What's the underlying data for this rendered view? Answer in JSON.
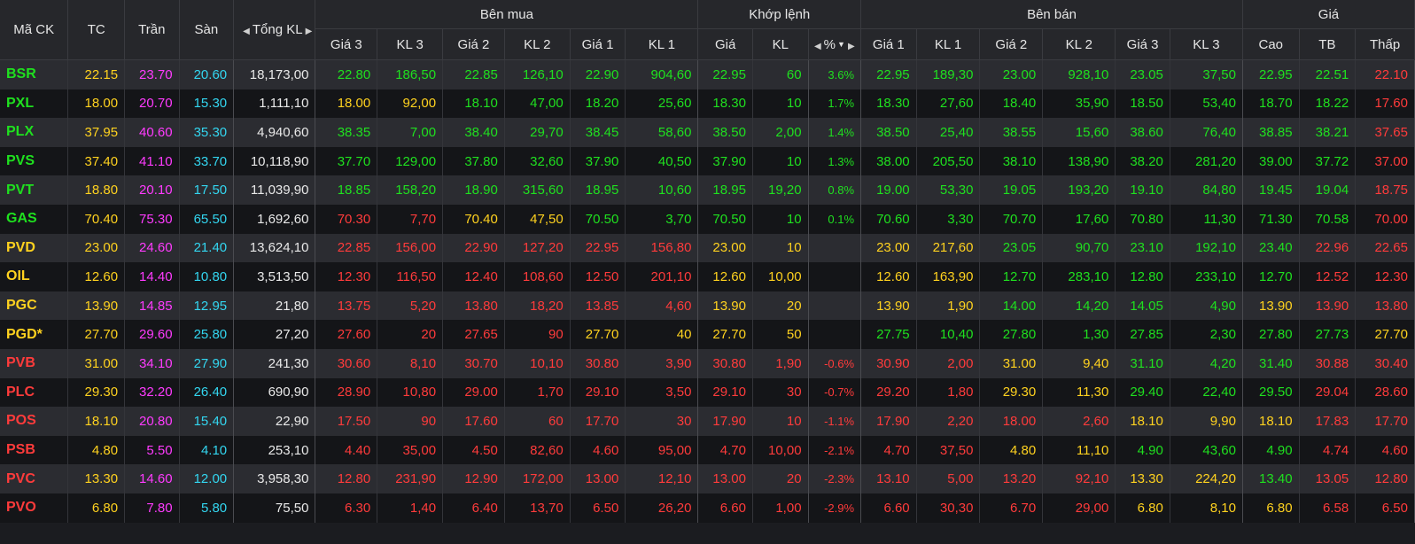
{
  "colors": {
    "green": "#1fe01f",
    "red": "#ff3b3b",
    "yellow": "#ffd21f",
    "purple": "#ff3bff",
    "cyan": "#33d6f0",
    "white": "#e9e9e9"
  },
  "header": {
    "symbol": "Mã CK",
    "ref": "TC",
    "ceil": "Trần",
    "floor": "Sàn",
    "total": "Tổng KL",
    "bid_group": "Bên mua",
    "match_group": "Khớp lệnh",
    "ask_group": "Bên bán",
    "price_group": "Giá",
    "bid_p3": "Giá 3",
    "bid_v3": "KL 3",
    "bid_p2": "Giá 2",
    "bid_v2": "KL 2",
    "bid_p1": "Giá 1",
    "bid_v1": "KL 1",
    "match_p": "Giá",
    "match_v": "KL",
    "match_pct": "%",
    "ask_p1": "Giá 1",
    "ask_v1": "KL 1",
    "ask_p2": "Giá 2",
    "ask_v2": "KL 2",
    "ask_p3": "Giá 3",
    "ask_v3": "KL 3",
    "high": "Cao",
    "avg": "TB",
    "low": "Thấp"
  },
  "rows": [
    {
      "sym": "BSR",
      "symc": "green",
      "tc": "22.15",
      "tran": "23.70",
      "san": "20.60",
      "tot": "18,173,00",
      "bp3": "22.80",
      "bp3c": "green",
      "bv3": "186,50",
      "bp2": "22.85",
      "bp2c": "green",
      "bv2": "126,10",
      "bp1": "22.90",
      "bp1c": "green",
      "bv1": "904,60",
      "mp": "22.95",
      "mpc": "green",
      "mv": "60",
      "pct": "3.6%",
      "ap1": "22.95",
      "ap1c": "green",
      "av1": "189,30",
      "ap2": "23.00",
      "ap2c": "green",
      "av2": "928,10",
      "ap3": "23.05",
      "ap3c": "green",
      "av3": "37,50",
      "hi": "22.95",
      "hic": "green",
      "avg": "22.51",
      "avgc": "green",
      "lo": "22.10",
      "loc": "red"
    },
    {
      "sym": "PXL",
      "symc": "green",
      "tc": "18.00",
      "tran": "20.70",
      "san": "15.30",
      "tot": "1,111,10",
      "bp3": "18.00",
      "bp3c": "yellow",
      "bv3": "92,00",
      "bp2": "18.10",
      "bp2c": "green",
      "bv2": "47,00",
      "bp1": "18.20",
      "bp1c": "green",
      "bv1": "25,60",
      "mp": "18.30",
      "mpc": "green",
      "mv": "10",
      "pct": "1.7%",
      "ap1": "18.30",
      "ap1c": "green",
      "av1": "27,60",
      "ap2": "18.40",
      "ap2c": "green",
      "av2": "35,90",
      "ap3": "18.50",
      "ap3c": "green",
      "av3": "53,40",
      "hi": "18.70",
      "hic": "green",
      "avg": "18.22",
      "avgc": "green",
      "lo": "17.60",
      "loc": "red"
    },
    {
      "sym": "PLX",
      "symc": "green",
      "tc": "37.95",
      "tran": "40.60",
      "san": "35.30",
      "tot": "4,940,60",
      "bp3": "38.35",
      "bp3c": "green",
      "bv3": "7,00",
      "bp2": "38.40",
      "bp2c": "green",
      "bv2": "29,70",
      "bp1": "38.45",
      "bp1c": "green",
      "bv1": "58,60",
      "mp": "38.50",
      "mpc": "green",
      "mv": "2,00",
      "pct": "1.4%",
      "ap1": "38.50",
      "ap1c": "green",
      "av1": "25,40",
      "ap2": "38.55",
      "ap2c": "green",
      "av2": "15,60",
      "ap3": "38.60",
      "ap3c": "green",
      "av3": "76,40",
      "hi": "38.85",
      "hic": "green",
      "avg": "38.21",
      "avgc": "green",
      "lo": "37.65",
      "loc": "red"
    },
    {
      "sym": "PVS",
      "symc": "green",
      "tc": "37.40",
      "tran": "41.10",
      "san": "33.70",
      "tot": "10,118,90",
      "bp3": "37.70",
      "bp3c": "green",
      "bv3": "129,00",
      "bp2": "37.80",
      "bp2c": "green",
      "bv2": "32,60",
      "bp1": "37.90",
      "bp1c": "green",
      "bv1": "40,50",
      "mp": "37.90",
      "mpc": "green",
      "mv": "10",
      "pct": "1.3%",
      "ap1": "38.00",
      "ap1c": "green",
      "av1": "205,50",
      "ap2": "38.10",
      "ap2c": "green",
      "av2": "138,90",
      "ap3": "38.20",
      "ap3c": "green",
      "av3": "281,20",
      "hi": "39.00",
      "hic": "green",
      "avg": "37.72",
      "avgc": "green",
      "lo": "37.00",
      "loc": "red"
    },
    {
      "sym": "PVT",
      "symc": "green",
      "tc": "18.80",
      "tran": "20.10",
      "san": "17.50",
      "tot": "11,039,90",
      "bp3": "18.85",
      "bp3c": "green",
      "bv3": "158,20",
      "bp2": "18.90",
      "bp2c": "green",
      "bv2": "315,60",
      "bp1": "18.95",
      "bp1c": "green",
      "bv1": "10,60",
      "mp": "18.95",
      "mpc": "green",
      "mv": "19,20",
      "pct": "0.8%",
      "ap1": "19.00",
      "ap1c": "green",
      "av1": "53,30",
      "ap2": "19.05",
      "ap2c": "green",
      "av2": "193,20",
      "ap3": "19.10",
      "ap3c": "green",
      "av3": "84,80",
      "hi": "19.45",
      "hic": "green",
      "avg": "19.04",
      "avgc": "green",
      "lo": "18.75",
      "loc": "red"
    },
    {
      "sym": "GAS",
      "symc": "green",
      "tc": "70.40",
      "tran": "75.30",
      "san": "65.50",
      "tot": "1,692,60",
      "bp3": "70.30",
      "bp3c": "red",
      "bv3": "7,70",
      "bp2": "70.40",
      "bp2c": "yellow",
      "bv2": "47,50",
      "bp1": "70.50",
      "bp1c": "green",
      "bv1": "3,70",
      "mp": "70.50",
      "mpc": "green",
      "mv": "10",
      "pct": "0.1%",
      "ap1": "70.60",
      "ap1c": "green",
      "av1": "3,30",
      "ap2": "70.70",
      "ap2c": "green",
      "av2": "17,60",
      "ap3": "70.80",
      "ap3c": "green",
      "av3": "11,30",
      "hi": "71.30",
      "hic": "green",
      "avg": "70.58",
      "avgc": "green",
      "lo": "70.00",
      "loc": "red"
    },
    {
      "sym": "PVD",
      "symc": "yellow",
      "tc": "23.00",
      "tran": "24.60",
      "san": "21.40",
      "tot": "13,624,10",
      "bp3": "22.85",
      "bp3c": "red",
      "bv3": "156,00",
      "bp2": "22.90",
      "bp2c": "red",
      "bv2": "127,20",
      "bp1": "22.95",
      "bp1c": "red",
      "bv1": "156,80",
      "mp": "23.00",
      "mpc": "yellow",
      "mv": "10",
      "pct": "",
      "ap1": "23.00",
      "ap1c": "yellow",
      "av1": "217,60",
      "ap2": "23.05",
      "ap2c": "green",
      "av2": "90,70",
      "ap3": "23.10",
      "ap3c": "green",
      "av3": "192,10",
      "hi": "23.40",
      "hic": "green",
      "avg": "22.96",
      "avgc": "red",
      "lo": "22.65",
      "loc": "red"
    },
    {
      "sym": "OIL",
      "symc": "yellow",
      "tc": "12.60",
      "tran": "14.40",
      "san": "10.80",
      "tot": "3,513,50",
      "bp3": "12.30",
      "bp3c": "red",
      "bv3": "116,50",
      "bp2": "12.40",
      "bp2c": "red",
      "bv2": "108,60",
      "bp1": "12.50",
      "bp1c": "red",
      "bv1": "201,10",
      "mp": "12.60",
      "mpc": "yellow",
      "mv": "10,00",
      "pct": "",
      "ap1": "12.60",
      "ap1c": "yellow",
      "av1": "163,90",
      "ap2": "12.70",
      "ap2c": "green",
      "av2": "283,10",
      "ap3": "12.80",
      "ap3c": "green",
      "av3": "233,10",
      "hi": "12.70",
      "hic": "green",
      "avg": "12.52",
      "avgc": "red",
      "lo": "12.30",
      "loc": "red"
    },
    {
      "sym": "PGC",
      "symc": "yellow",
      "tc": "13.90",
      "tran": "14.85",
      "san": "12.95",
      "tot": "21,80",
      "bp3": "13.75",
      "bp3c": "red",
      "bv3": "5,20",
      "bp2": "13.80",
      "bp2c": "red",
      "bv2": "18,20",
      "bp1": "13.85",
      "bp1c": "red",
      "bv1": "4,60",
      "mp": "13.90",
      "mpc": "yellow",
      "mv": "20",
      "pct": "",
      "ap1": "13.90",
      "ap1c": "yellow",
      "av1": "1,90",
      "ap2": "14.00",
      "ap2c": "green",
      "av2": "14,20",
      "ap3": "14.05",
      "ap3c": "green",
      "av3": "4,90",
      "hi": "13.90",
      "hic": "yellow",
      "avg": "13.90",
      "avgc": "red",
      "lo": "13.80",
      "loc": "red"
    },
    {
      "sym": "PGD*",
      "symc": "yellow",
      "tc": "27.70",
      "tran": "29.60",
      "san": "25.80",
      "tot": "27,20",
      "bp3": "27.60",
      "bp3c": "red",
      "bv3": "20",
      "bp2": "27.65",
      "bp2c": "red",
      "bv2": "90",
      "bp1": "27.70",
      "bp1c": "yellow",
      "bv1": "40",
      "mp": "27.70",
      "mpc": "yellow",
      "mv": "50",
      "pct": "",
      "ap1": "27.75",
      "ap1c": "green",
      "av1": "10,40",
      "ap2": "27.80",
      "ap2c": "green",
      "av2": "1,30",
      "ap3": "27.85",
      "ap3c": "green",
      "av3": "2,30",
      "hi": "27.80",
      "hic": "green",
      "avg": "27.73",
      "avgc": "green",
      "lo": "27.70",
      "loc": "yellow"
    },
    {
      "sym": "PVB",
      "symc": "red",
      "tc": "31.00",
      "tran": "34.10",
      "san": "27.90",
      "tot": "241,30",
      "bp3": "30.60",
      "bp3c": "red",
      "bv3": "8,10",
      "bp2": "30.70",
      "bp2c": "red",
      "bv2": "10,10",
      "bp1": "30.80",
      "bp1c": "red",
      "bv1": "3,90",
      "mp": "30.80",
      "mpc": "red",
      "mv": "1,90",
      "pct": "-0.6%",
      "ap1": "30.90",
      "ap1c": "red",
      "av1": "2,00",
      "ap2": "31.00",
      "ap2c": "yellow",
      "av2": "9,40",
      "ap3": "31.10",
      "ap3c": "green",
      "av3": "4,20",
      "hi": "31.40",
      "hic": "green",
      "avg": "30.88",
      "avgc": "red",
      "lo": "30.40",
      "loc": "red"
    },
    {
      "sym": "PLC",
      "symc": "red",
      "tc": "29.30",
      "tran": "32.20",
      "san": "26.40",
      "tot": "690,90",
      "bp3": "28.90",
      "bp3c": "red",
      "bv3": "10,80",
      "bp2": "29.00",
      "bp2c": "red",
      "bv2": "1,70",
      "bp1": "29.10",
      "bp1c": "red",
      "bv1": "3,50",
      "mp": "29.10",
      "mpc": "red",
      "mv": "30",
      "pct": "-0.7%",
      "ap1": "29.20",
      "ap1c": "red",
      "av1": "1,80",
      "ap2": "29.30",
      "ap2c": "yellow",
      "av2": "11,30",
      "ap3": "29.40",
      "ap3c": "green",
      "av3": "22,40",
      "hi": "29.50",
      "hic": "green",
      "avg": "29.04",
      "avgc": "red",
      "lo": "28.60",
      "loc": "red"
    },
    {
      "sym": "POS",
      "symc": "red",
      "tc": "18.10",
      "tran": "20.80",
      "san": "15.40",
      "tot": "22,90",
      "bp3": "17.50",
      "bp3c": "red",
      "bv3": "90",
      "bp2": "17.60",
      "bp2c": "red",
      "bv2": "60",
      "bp1": "17.70",
      "bp1c": "red",
      "bv1": "30",
      "mp": "17.90",
      "mpc": "red",
      "mv": "10",
      "pct": "-1.1%",
      "ap1": "17.90",
      "ap1c": "red",
      "av1": "2,20",
      "ap2": "18.00",
      "ap2c": "red",
      "av2": "2,60",
      "ap3": "18.10",
      "ap3c": "yellow",
      "av3": "9,90",
      "hi": "18.10",
      "hic": "yellow",
      "avg": "17.83",
      "avgc": "red",
      "lo": "17.70",
      "loc": "red"
    },
    {
      "sym": "PSB",
      "symc": "red",
      "tc": "4.80",
      "tran": "5.50",
      "san": "4.10",
      "tot": "253,10",
      "bp3": "4.40",
      "bp3c": "red",
      "bv3": "35,00",
      "bp2": "4.50",
      "bp2c": "red",
      "bv2": "82,60",
      "bp1": "4.60",
      "bp1c": "red",
      "bv1": "95,00",
      "mp": "4.70",
      "mpc": "red",
      "mv": "10,00",
      "pct": "-2.1%",
      "ap1": "4.70",
      "ap1c": "red",
      "av1": "37,50",
      "ap2": "4.80",
      "ap2c": "yellow",
      "av2": "11,10",
      "ap3": "4.90",
      "ap3c": "green",
      "av3": "43,60",
      "hi": "4.90",
      "hic": "green",
      "avg": "4.74",
      "avgc": "red",
      "lo": "4.60",
      "loc": "red"
    },
    {
      "sym": "PVC",
      "symc": "red",
      "tc": "13.30",
      "tran": "14.60",
      "san": "12.00",
      "tot": "3,958,30",
      "bp3": "12.80",
      "bp3c": "red",
      "bv3": "231,90",
      "bp2": "12.90",
      "bp2c": "red",
      "bv2": "172,00",
      "bp1": "13.00",
      "bp1c": "red",
      "bv1": "12,10",
      "mp": "13.00",
      "mpc": "red",
      "mv": "20",
      "pct": "-2.3%",
      "ap1": "13.10",
      "ap1c": "red",
      "av1": "5,00",
      "ap2": "13.20",
      "ap2c": "red",
      "av2": "92,10",
      "ap3": "13.30",
      "ap3c": "yellow",
      "av3": "224,20",
      "hi": "13.40",
      "hic": "green",
      "avg": "13.05",
      "avgc": "red",
      "lo": "12.80",
      "loc": "red"
    },
    {
      "sym": "PVO",
      "symc": "red",
      "tc": "6.80",
      "tran": "7.80",
      "san": "5.80",
      "tot": "75,50",
      "bp3": "6.30",
      "bp3c": "red",
      "bv3": "1,40",
      "bp2": "6.40",
      "bp2c": "red",
      "bv2": "13,70",
      "bp1": "6.50",
      "bp1c": "red",
      "bv1": "26,20",
      "mp": "6.60",
      "mpc": "red",
      "mv": "1,00",
      "pct": "-2.9%",
      "ap1": "6.60",
      "ap1c": "red",
      "av1": "30,30",
      "ap2": "6.70",
      "ap2c": "red",
      "av2": "29,00",
      "ap3": "6.80",
      "ap3c": "yellow",
      "av3": "8,10",
      "hi": "6.80",
      "hic": "yellow",
      "avg": "6.58",
      "avgc": "red",
      "lo": "6.50",
      "loc": "red"
    }
  ]
}
